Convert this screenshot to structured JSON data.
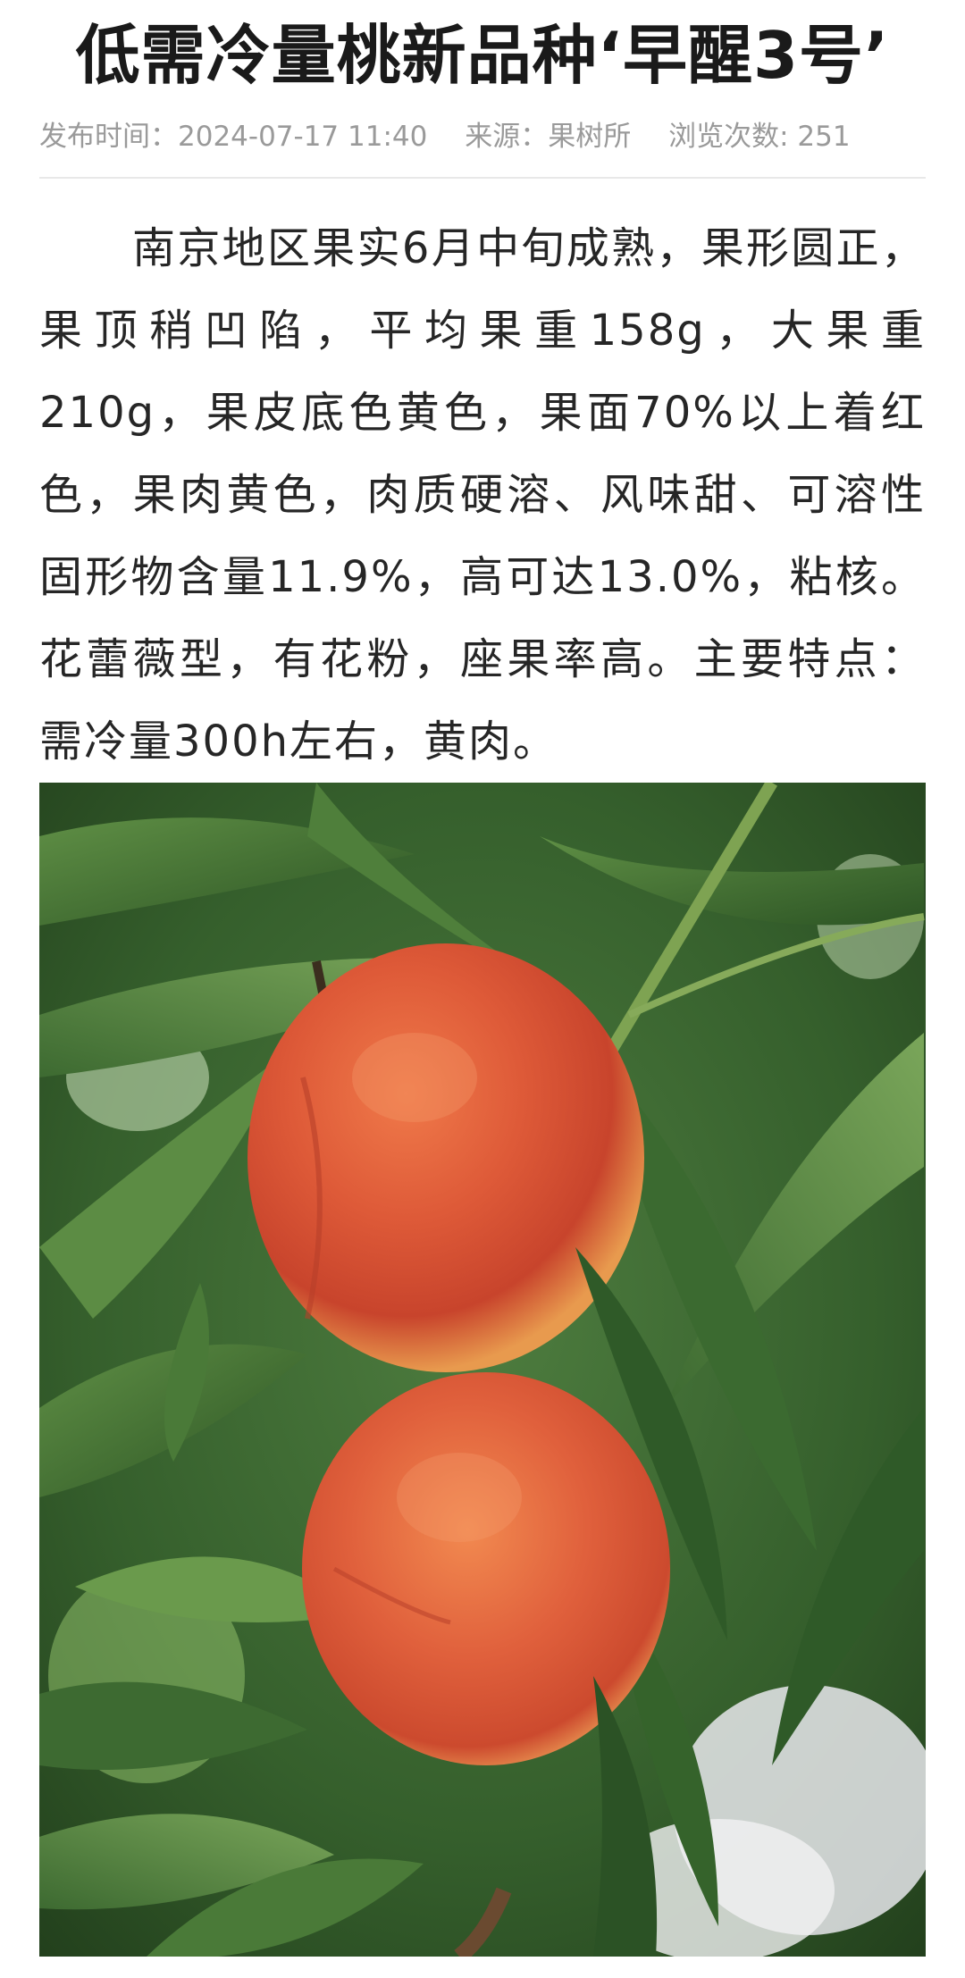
{
  "article": {
    "title": "低需冷量桃新品种‘早醒3号’",
    "meta": {
      "publish_time": "发布时间：2024-07-17 11:40",
      "source": "来源：果树所",
      "views": "浏览次数: 251"
    },
    "body": "南京地区果实6月中旬成熟，果形圆正，果顶稍凹陷，平均果重158g，大果重210g，果皮底色黄色，果面70%以上着红色，果肉黄色，肉质硬溶、风味甜、可溶性固形物含量11.9%，高可达13.0%，粘核。花蕾薇型，有花粉，座果率高。主要特点：需冷量300h左右，黄肉。"
  },
  "photo": {
    "subject": "two-peaches-on-branch"
  },
  "colors": {
    "leaf_dark": "#2f5a28",
    "leaf_light": "#6c9a4e",
    "peach_red": "#d8503a",
    "peach_yellow": "#f2b25a"
  }
}
